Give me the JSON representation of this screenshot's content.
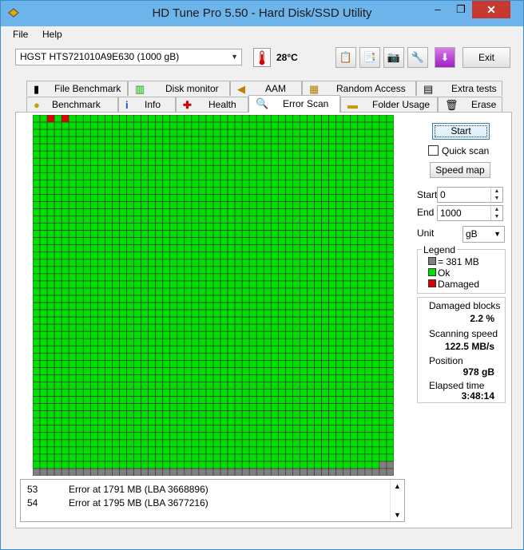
{
  "window": {
    "title": "HD Tune Pro 5.50 - Hard Disk/SSD Utility",
    "min": "‒",
    "max": "❐",
    "close": "✕"
  },
  "menu": [
    {
      "label": "File"
    },
    {
      "label": "Help"
    }
  ],
  "toolbar": {
    "drive": "HGST HTS721010A9E630 (1000 gB)",
    "temperature": "28°C",
    "exit_label": "Exit",
    "icons": [
      "copy-info-icon",
      "copy-icon",
      "screenshot-camera-icon",
      "options-wrench-icon",
      "download-update-icon"
    ]
  },
  "tabs_top": [
    "File Benchmark",
    "Disk monitor",
    "AAM",
    "Random Access",
    "Extra tests"
  ],
  "tabs_bottom": [
    "Benchmark",
    "Info",
    "Health",
    "Error Scan",
    "Folder Usage",
    "Erase"
  ],
  "active_tab": "Error Scan",
  "controls": {
    "start_label": "Start",
    "quick_scan_label": "Quick scan",
    "quick_scan_checked": false,
    "speed_map_label": "Speed map",
    "start_field_label": "Start",
    "start_value": "0",
    "end_field_label": "End",
    "end_value": "1000",
    "unit_label": "Unit",
    "unit_value": "gB"
  },
  "legend": {
    "title": "Legend",
    "block_size": "= 381 MB",
    "ok": "Ok",
    "damaged": "Damaged",
    "colors": {
      "unscanned": "#808080",
      "ok": "#00e000",
      "damaged": "#e00000"
    }
  },
  "stats": {
    "damaged_blocks_label": "Damaged blocks",
    "damaged_blocks_value": "2.2 %",
    "scanning_speed_label": "Scanning speed",
    "scanning_speed_value": "122.5 MB/s",
    "position_label": "Position",
    "position_value": "978 gB",
    "elapsed_label": "Elapsed time",
    "elapsed_value": "3:48:14"
  },
  "scan_grid": {
    "columns": 50,
    "rows": 50,
    "damaged_cells": [
      [
        0,
        2
      ],
      [
        0,
        4
      ]
    ],
    "unscanned_last_row_from": 0,
    "unscanned_second_last_row_from": 48
  },
  "log": [
    {
      "num": "53",
      "text": "Error at 1791 MB (LBA 3668896)"
    },
    {
      "num": "54",
      "text": "Error at 1795 MB (LBA 3677216)"
    }
  ]
}
